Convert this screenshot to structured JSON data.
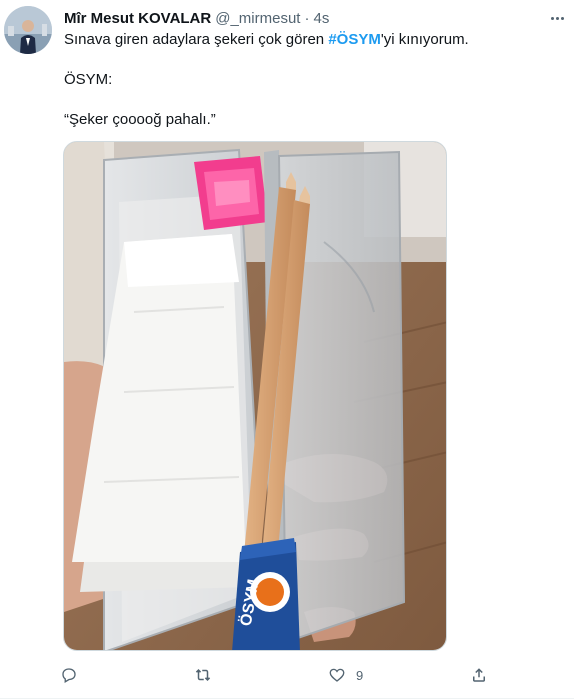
{
  "tweet": {
    "author_name": "Mîr Mesut KOVALAR",
    "handle": "@_mirmesut",
    "separator": "·",
    "time": "4s",
    "text_before": "Sınava giren adaylara şekeri çok gören ",
    "hashtag": "#ÖSYM",
    "text_after": "'yi kınıyorum.",
    "line2": "ÖSYM:",
    "line3": "“Şeker çooooğ pahalı.”"
  },
  "media": {
    "eraser_label": "ÖSYM",
    "eraser_brand_color": "#e8701a"
  },
  "actions": {
    "reply_count": "",
    "retweet_count": "",
    "like_count": "9"
  },
  "colors": {
    "hashtag": "#1d9bf0",
    "secondary_text": "#536471",
    "primary_text": "#0f1419"
  }
}
